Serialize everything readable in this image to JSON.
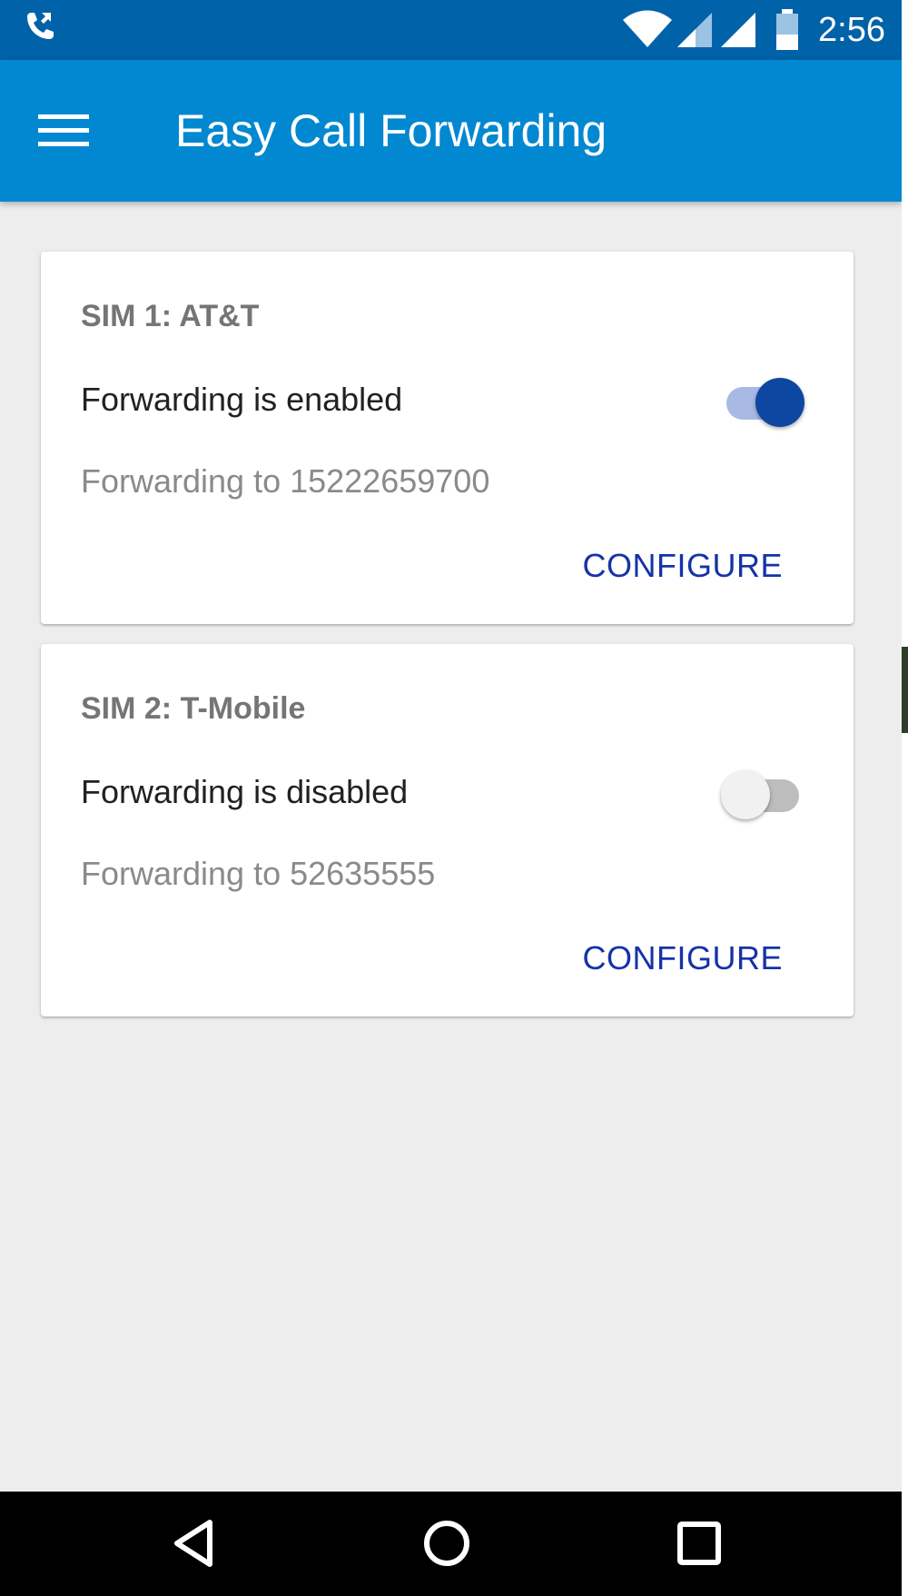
{
  "status_bar": {
    "time": "2:56",
    "icons": [
      "call-forwarding-icon",
      "wifi-icon",
      "cell-signal-icon",
      "cell-signal-icon",
      "battery-icon"
    ]
  },
  "app_bar": {
    "title": "Easy Call Forwarding",
    "menu_icon": "menu-icon"
  },
  "cards": [
    {
      "sim_label": "SIM 1: AT&T",
      "status_text": "Forwarding is enabled",
      "forwarding_number_text": "Forwarding to 15222659700",
      "enabled": true,
      "configure_label": "CONFIGURE"
    },
    {
      "sim_label": "SIM 2: T-Mobile",
      "status_text": "Forwarding is disabled",
      "forwarding_number_text": "Forwarding to 52635555",
      "enabled": false,
      "configure_label": "CONFIGURE"
    }
  ],
  "nav_bar": {
    "icons": [
      "back-icon",
      "home-icon",
      "recents-icon"
    ]
  },
  "colors": {
    "status_bar": "#0062a8",
    "app_bar": "#0288d1",
    "background": "#ededed",
    "accent": "#0d47a1",
    "button_text": "#1533a8"
  }
}
